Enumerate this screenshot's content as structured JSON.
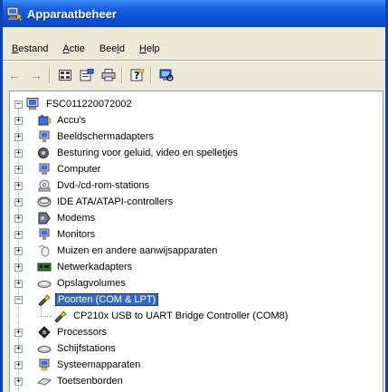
{
  "window": {
    "title": "Apparaatbeheer",
    "title_icon": "device-manager-icon",
    "accent": "#0a4fd4"
  },
  "menu": {
    "items": [
      {
        "key": "B",
        "rest": "estand"
      },
      {
        "key": "A",
        "rest": "ctie"
      },
      {
        "key": "",
        "pre": "Bee",
        "mid": "l",
        "post": "d"
      },
      {
        "key": "H",
        "rest": "elp"
      }
    ]
  },
  "toolbar": {
    "buttons": [
      "back-arrow-icon",
      "forward-arrow-icon",
      "view-icon",
      "properties-icon",
      "print-icon",
      "help-icon",
      "scan-hardware-icon"
    ],
    "back": "←",
    "forward": "→"
  },
  "tree": {
    "root": "FSC011220072002",
    "items": [
      {
        "label": "Accu's",
        "icon": "battery-icon",
        "expanded": false
      },
      {
        "label": "Beeldschermadapters",
        "icon": "display-adapter-icon",
        "expanded": false
      },
      {
        "label": "Besturing voor geluid, video en spelletjes",
        "icon": "sound-icon",
        "expanded": false
      },
      {
        "label": "Computer",
        "icon": "computer-icon",
        "expanded": false
      },
      {
        "label": "Dvd-/cd-rom-stations",
        "icon": "cdrom-icon",
        "expanded": false
      },
      {
        "label": "IDE ATA/ATAPI-controllers",
        "icon": "ide-controller-icon",
        "expanded": false
      },
      {
        "label": "Modems",
        "icon": "modem-icon",
        "expanded": false
      },
      {
        "label": "Monitors",
        "icon": "monitor-icon",
        "expanded": false
      },
      {
        "label": "Muizen en andere aanwijsapparaten",
        "icon": "mouse-icon",
        "expanded": false
      },
      {
        "label": "Netwerkadapters",
        "icon": "network-adapter-icon",
        "expanded": false
      },
      {
        "label": "Opslagvolumes",
        "icon": "storage-volume-icon",
        "expanded": false
      },
      {
        "label": "Poorten (COM & LPT)",
        "icon": "port-icon",
        "expanded": true,
        "selected": true
      },
      {
        "label": "CP210x USB to UART Bridge Controller (COM8)",
        "icon": "port-device-icon",
        "child": true
      },
      {
        "label": "Processors",
        "icon": "processor-icon",
        "expanded": false
      },
      {
        "label": "Schijfstations",
        "icon": "disk-drive-icon",
        "expanded": false
      },
      {
        "label": "Systeemapparaten",
        "icon": "system-device-icon",
        "expanded": false
      },
      {
        "label": "Toetsenborden",
        "icon": "keyboard-icon",
        "expanded": false
      }
    ],
    "selected_color": "#316ac5"
  }
}
